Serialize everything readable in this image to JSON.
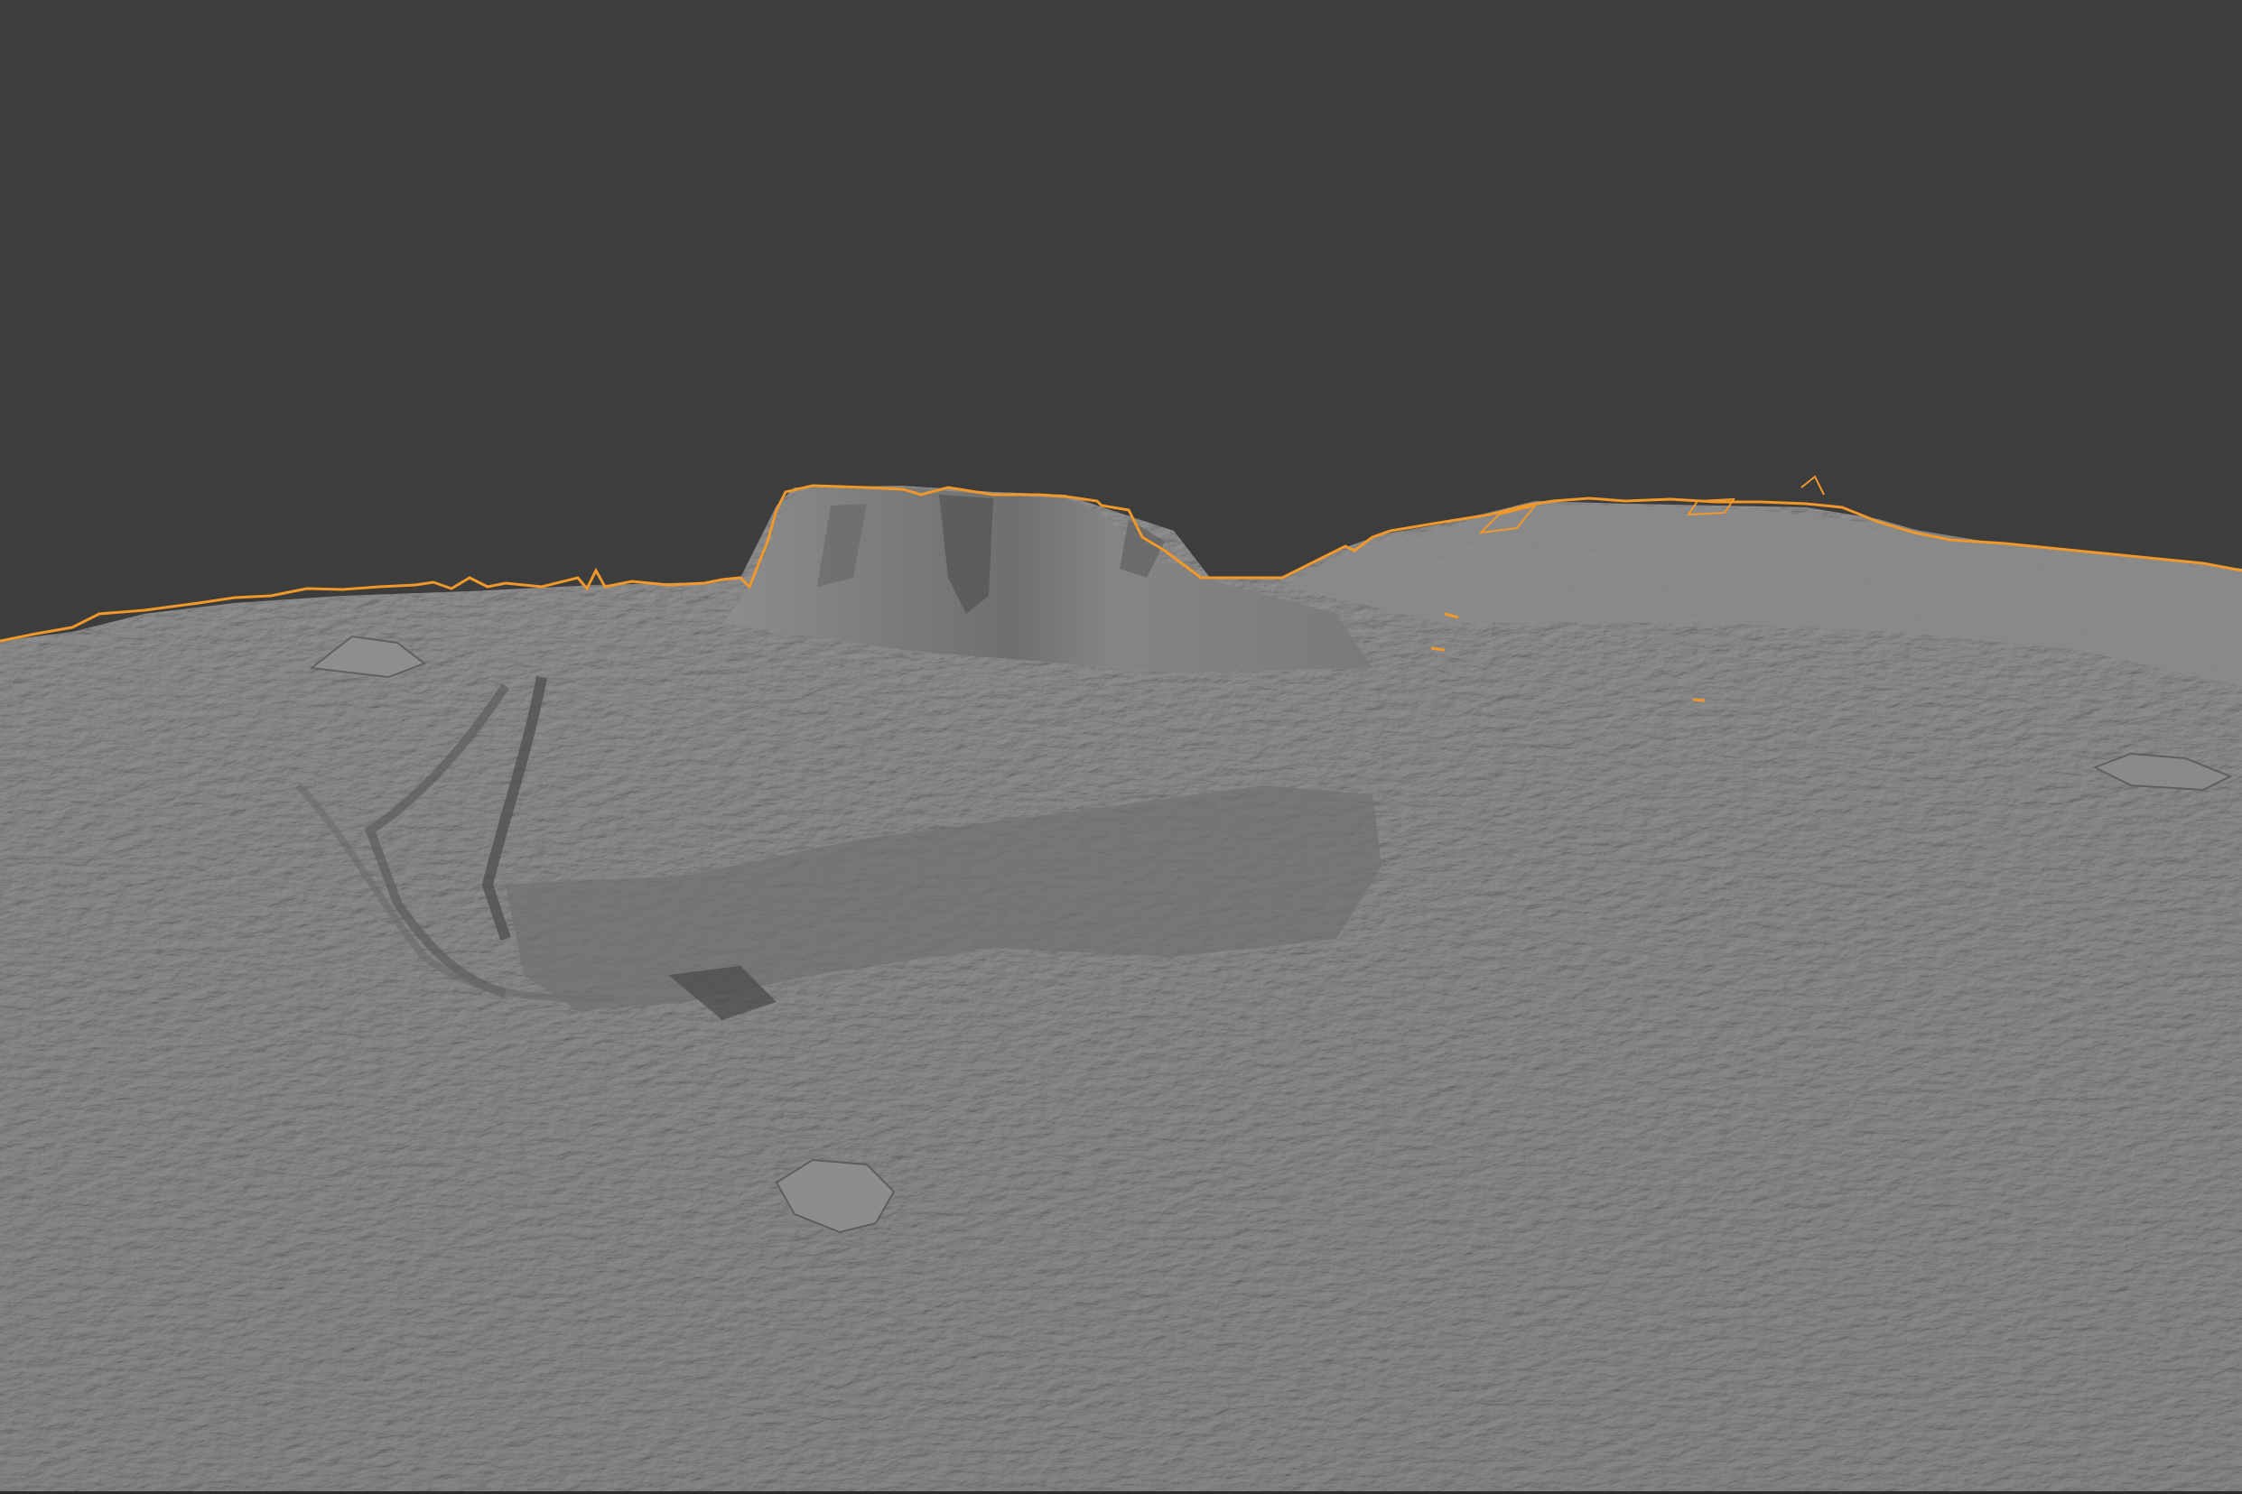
{
  "viewport": {
    "background_color": "#3d3d3d",
    "mesh_color": "#7d7d7d",
    "mesh_shadow_color": "#5a5a5a",
    "selection_outline_color": "#f0982a",
    "selected_object": "terrain-mesh"
  }
}
